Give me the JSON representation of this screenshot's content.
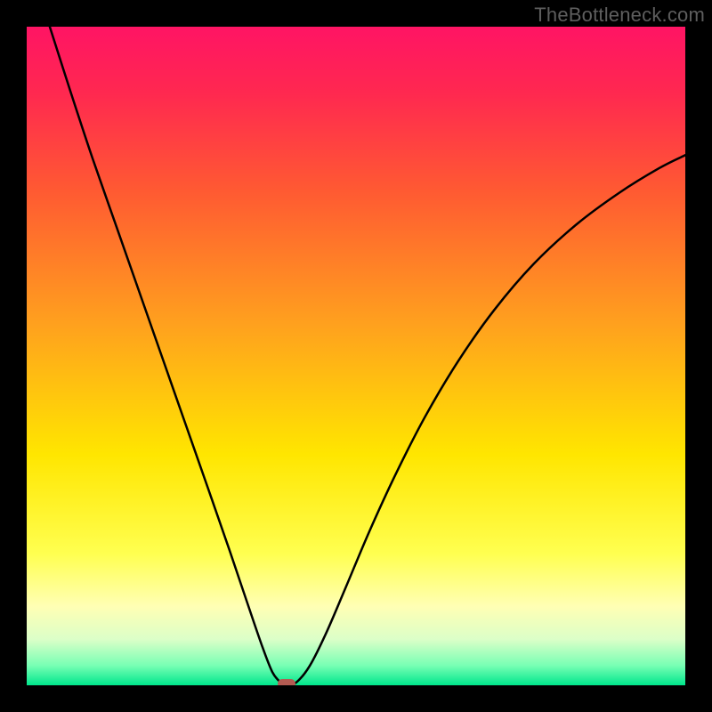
{
  "watermark": "TheBottleneck.com",
  "chart_data": {
    "type": "line",
    "title": "",
    "xlabel": "",
    "ylabel": "",
    "xlim": [
      0,
      1
    ],
    "ylim": [
      0,
      1
    ],
    "gradient_stops": [
      {
        "offset": 0.0,
        "color": "#ff1464"
      },
      {
        "offset": 0.1,
        "color": "#ff2850"
      },
      {
        "offset": 0.25,
        "color": "#ff5a32"
      },
      {
        "offset": 0.45,
        "color": "#ffa01e"
      },
      {
        "offset": 0.65,
        "color": "#ffe600"
      },
      {
        "offset": 0.8,
        "color": "#ffff50"
      },
      {
        "offset": 0.88,
        "color": "#ffffb4"
      },
      {
        "offset": 0.93,
        "color": "#dcffc8"
      },
      {
        "offset": 0.97,
        "color": "#78ffb4"
      },
      {
        "offset": 1.0,
        "color": "#00e68c"
      }
    ],
    "series": [
      {
        "name": "bottleneck-curve",
        "points": [
          {
            "x": 0.035,
            "y": 1.0
          },
          {
            "x": 0.067,
            "y": 0.9
          },
          {
            "x": 0.1,
            "y": 0.8
          },
          {
            "x": 0.135,
            "y": 0.7
          },
          {
            "x": 0.17,
            "y": 0.6
          },
          {
            "x": 0.205,
            "y": 0.5
          },
          {
            "x": 0.24,
            "y": 0.4
          },
          {
            "x": 0.275,
            "y": 0.3
          },
          {
            "x": 0.308,
            "y": 0.205
          },
          {
            "x": 0.335,
            "y": 0.125
          },
          {
            "x": 0.358,
            "y": 0.058
          },
          {
            "x": 0.373,
            "y": 0.02
          },
          {
            "x": 0.385,
            "y": 0.005
          },
          {
            "x": 0.395,
            "y": 0.0
          },
          {
            "x": 0.41,
            "y": 0.005
          },
          {
            "x": 0.43,
            "y": 0.03
          },
          {
            "x": 0.455,
            "y": 0.08
          },
          {
            "x": 0.485,
            "y": 0.15
          },
          {
            "x": 0.52,
            "y": 0.233
          },
          {
            "x": 0.56,
            "y": 0.32
          },
          {
            "x": 0.605,
            "y": 0.408
          },
          {
            "x": 0.655,
            "y": 0.492
          },
          {
            "x": 0.71,
            "y": 0.57
          },
          {
            "x": 0.77,
            "y": 0.64
          },
          {
            "x": 0.835,
            "y": 0.7
          },
          {
            "x": 0.9,
            "y": 0.748
          },
          {
            "x": 0.96,
            "y": 0.785
          },
          {
            "x": 1.0,
            "y": 0.805
          }
        ]
      }
    ],
    "marker": {
      "x": 0.395,
      "y": 0.003,
      "color": "#b35b52"
    }
  }
}
